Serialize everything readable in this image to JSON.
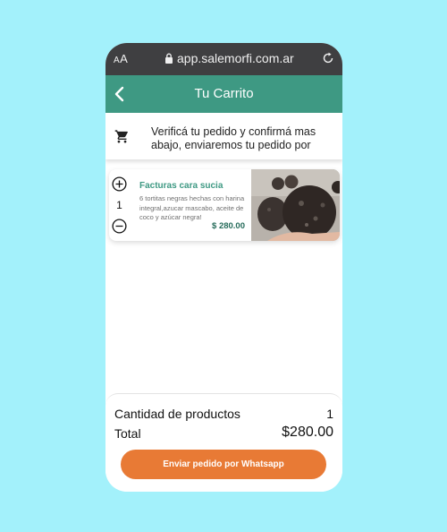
{
  "browser": {
    "text_size_label_small": "A",
    "text_size_label": "A",
    "url": "app.salemorfi.com.ar"
  },
  "header": {
    "title": "Tu Carrito"
  },
  "info": {
    "message": "Verificá tu pedido y confirmá mas abajo, enviaremos tu pedido por"
  },
  "cart_items": [
    {
      "name": "Facturas cara sucia",
      "description": "6 tortitas negras hechas con harina integral,azucar mascabo, aceite de coco y azúcar negra!",
      "price": "$ 280.00",
      "quantity": "1"
    }
  ],
  "summary": {
    "count_label": "Cantidad de productos",
    "count_value": "1",
    "total_label": "Total",
    "total_value": "$280.00"
  },
  "actions": {
    "send_label": "Enviar pedido por Whatsapp"
  },
  "colors": {
    "background": "#a3f1fb",
    "header": "#3e9983",
    "accent_button": "#e87a35",
    "browser_bar": "#3f3f41"
  }
}
